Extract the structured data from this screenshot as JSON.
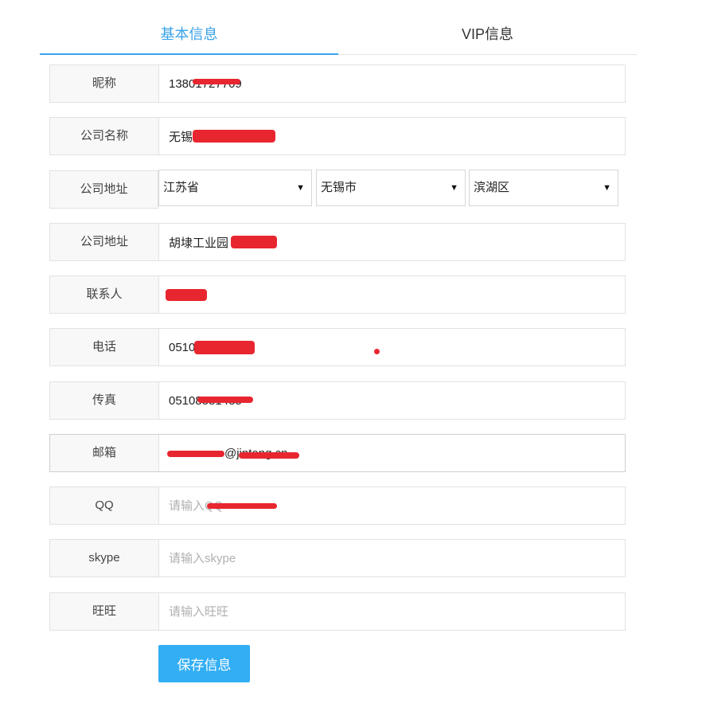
{
  "tabs": [
    {
      "label": "基本信息",
      "active": true
    },
    {
      "label": "VIP信息",
      "active": false
    }
  ],
  "form": {
    "nickname": {
      "label": "昵称",
      "value": "13801727709"
    },
    "company_name": {
      "label": "公司名称",
      "value": "无锡 限公司"
    },
    "company_region": {
      "label": "公司地址",
      "province": "江苏省",
      "city": "无锡市",
      "district": "滨湖区"
    },
    "company_address": {
      "label": "公司地址",
      "value": "胡埭工业园 号"
    },
    "contact": {
      "label": "联系人",
      "value": ""
    },
    "phone": {
      "label": "电话",
      "value": "0510"
    },
    "fax": {
      "label": "传真",
      "value": "05108581485"
    },
    "email": {
      "label": "邮箱",
      "value": "@jintong.cn"
    },
    "qq": {
      "label": "QQ",
      "placeholder": "请输入QQ"
    },
    "skype": {
      "label": "skype",
      "placeholder": "请输入skype"
    },
    "wangwang": {
      "label": "旺旺",
      "placeholder": "请输入旺旺"
    }
  },
  "dropdown_arrow": "▼",
  "actions": {
    "save_label": "保存信息"
  },
  "colors": {
    "accent": "#3aa3e8",
    "button": "#32aef5",
    "redaction": "#e8262f"
  }
}
